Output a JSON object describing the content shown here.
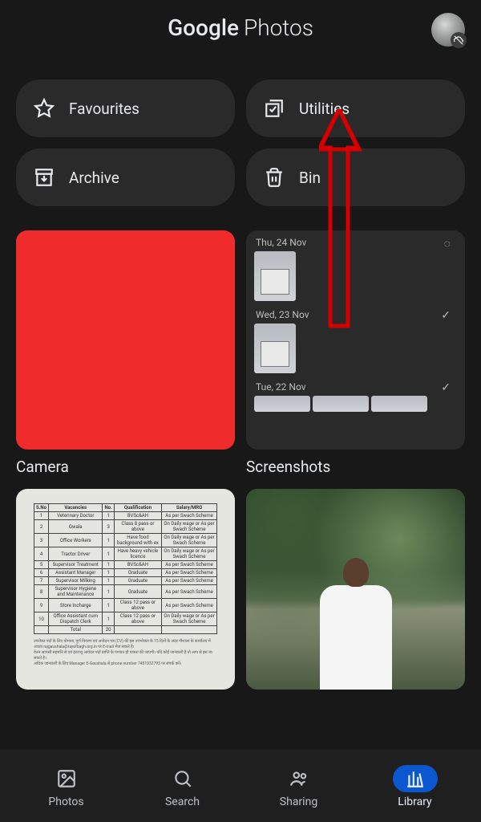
{
  "header": {
    "title_brand": "Google",
    "title_app": "Photos"
  },
  "actions": {
    "favourites": "Favourites",
    "utilities": "Utilities",
    "archive": "Archive",
    "bin": "Bin"
  },
  "albums": {
    "camera_label": "Camera",
    "screenshots_label": "Screenshots",
    "screenshots": {
      "dates": [
        "Thu, 24 Nov",
        "Wed, 23 Nov",
        "Tue, 22 Nov"
      ]
    }
  },
  "nav": {
    "photos": "Photos",
    "search": "Search",
    "sharing": "Sharing",
    "library": "Library"
  },
  "doc_table": {
    "headers": [
      "S.No",
      "Vacancies",
      "No.",
      "Qualification",
      "Salary/MRG"
    ],
    "rows": [
      [
        "1",
        "Veterinary Doctor",
        "1",
        "BVSc&AH",
        "As per Swach Scheme"
      ],
      [
        "2",
        "Gwala",
        "3",
        "Class 8 pass or above",
        "On Daily wage or As per Swach Scheme"
      ],
      [
        "3",
        "Office Workers",
        "1",
        "Have food background with ex",
        "On Daily wage or As per Swach Scheme"
      ],
      [
        "4",
        "Tractor Driver",
        "1",
        "Have heavy vehicle licence",
        "On Daily wage or As per Swach Scheme"
      ],
      [
        "5",
        "Supervisor Treatment",
        "1",
        "BVSc&AH",
        "As per Swach Scheme"
      ],
      [
        "6",
        "Assistant Manager",
        "1",
        "Graduate",
        "As per Swach Scheme"
      ],
      [
        "7",
        "Supervisor Milking",
        "1",
        "Graduate",
        "As per Swach Scheme"
      ],
      [
        "8",
        "Supervisor Hygiene and Maintenance",
        "1",
        "Graduate",
        "As per Swach Scheme"
      ],
      [
        "9",
        "Store Incharge",
        "1",
        "Class 12 pass or above",
        "As per Swach Scheme"
      ],
      [
        "10",
        "Office Assistant cum Dispatch Clerk",
        "1",
        "Class 12 pass or above",
        "On Daily wage or As per Swach Scheme"
      ]
    ],
    "total_label": "Total",
    "total_value": "20"
  }
}
